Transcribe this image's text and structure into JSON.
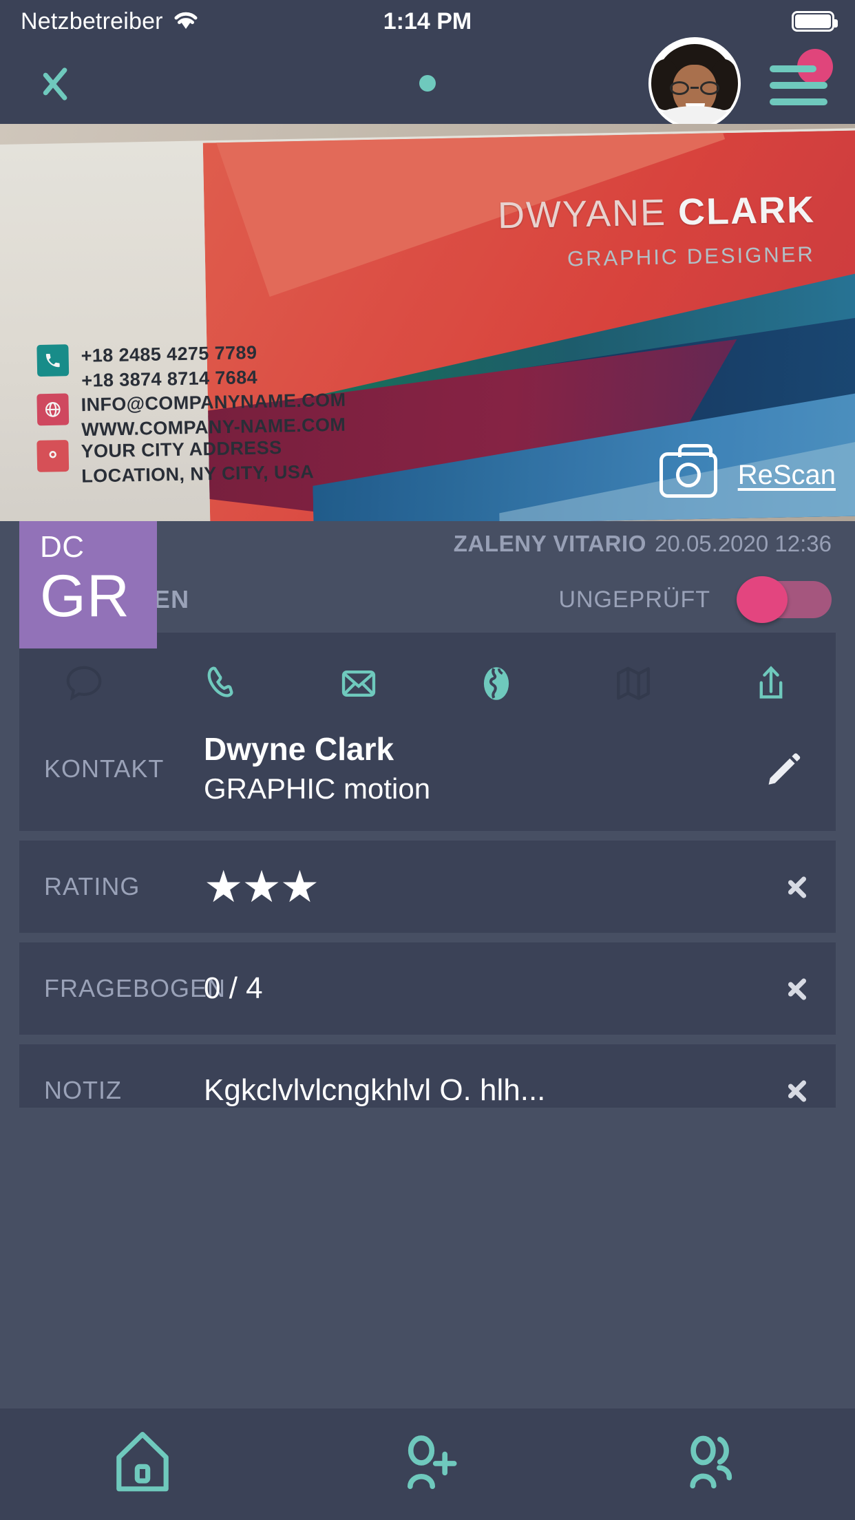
{
  "status_bar": {
    "carrier": "Netzbetreiber",
    "time": "1:14 PM",
    "wifi_icon": "wifi-icon",
    "battery_icon": "battery-full-icon"
  },
  "nav_bar": {
    "back_icon": "chevron-left-icon",
    "page_dot": "page-indicator-dot",
    "avatar": "user-avatar",
    "menu_icon": "hamburger-menu-icon",
    "menu_badge": "notification-badge"
  },
  "business_card": {
    "name_first": "DWYANE",
    "name_last": "CLARK",
    "role": "GRAPHIC DESIGNER",
    "phone_1": "+18 2485 4275 7789",
    "phone_2": "+18 3874 8714 7684",
    "email": "INFO@COMPANYNAME.COM",
    "website": "WWW.COMPANY-NAME.COM",
    "address_1": "YOUR CITY ADDRESS",
    "address_2": "LOCATION, NY CITY, USA",
    "phone_icon": "phone-icon",
    "web_icon": "globe-icon",
    "address_icon": "location-pin-icon"
  },
  "initials_badge": {
    "small": "DC",
    "large": "GR"
  },
  "rescan": {
    "label": "ReScan",
    "camera_icon": "camera-icon"
  },
  "meta": {
    "company": "ZALENY VITARIO",
    "date": "20.05.2020 12:36"
  },
  "lead": {
    "title": "LEAD DATEN",
    "status": "UNGEPRÜFT",
    "toggle_state": "off",
    "toggle_color": "#e3457f"
  },
  "actions": [
    {
      "name": "chat-icon",
      "label": "Chat",
      "enabled": false
    },
    {
      "name": "phone-icon",
      "label": "Anrufen",
      "enabled": true
    },
    {
      "name": "mail-icon",
      "label": "E-Mail",
      "enabled": true
    },
    {
      "name": "globe-icon",
      "label": "Website",
      "enabled": true
    },
    {
      "name": "map-icon",
      "label": "Karte",
      "enabled": false
    },
    {
      "name": "share-icon",
      "label": "Teilen",
      "enabled": true
    }
  ],
  "rows": {
    "kontakt": {
      "label": "KONTAKT",
      "name": "Dwyne Clark",
      "company": "GRAPHIC motion",
      "edit_icon": "pencil-icon"
    },
    "rating": {
      "label": "RATING",
      "stars_filled": 3,
      "stars_glyph": "★★★"
    },
    "fragebogen": {
      "label": "FRAGEBOGEN",
      "value": "0 / 4"
    },
    "notiz": {
      "label": "NOTIZ",
      "value": "Kgkclvlvlcngkhlvl O. hlh..."
    }
  },
  "tab_bar": [
    {
      "name": "home-icon",
      "label": "Home"
    },
    {
      "name": "add-person-icon",
      "label": "Neuer Lead"
    },
    {
      "name": "group-icon",
      "label": "Leads"
    }
  ],
  "colors": {
    "background": "#474f63",
    "surface": "#3b4257",
    "accent_teal": "#6fc9bd",
    "accent_pink": "#e0457b",
    "muted_text": "#9aa2b8",
    "badge_purple": "#9272b8"
  }
}
